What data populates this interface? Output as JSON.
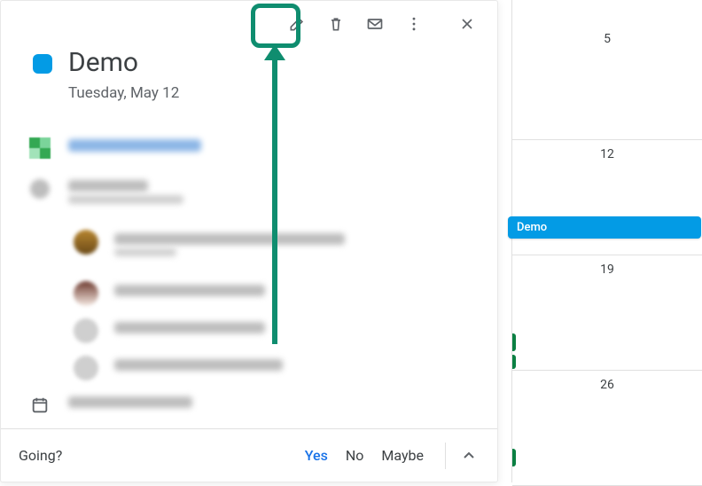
{
  "event": {
    "title": "Demo",
    "date_text": "Tuesday, May 12",
    "color": "#039be5"
  },
  "calendar": {
    "days": [
      {
        "num": "5"
      },
      {
        "num": "12"
      },
      {
        "num": "19"
      },
      {
        "num": "26"
      }
    ],
    "chip_label": "Demo"
  },
  "rsvp": {
    "question": "Going?",
    "yes": "Yes",
    "no": "No",
    "maybe": "Maybe"
  },
  "icons": {
    "edit": "edit-icon",
    "delete": "delete-icon",
    "mail": "mail-icon",
    "more": "more-icon",
    "close": "close-icon",
    "calendar": "calendar-icon"
  }
}
